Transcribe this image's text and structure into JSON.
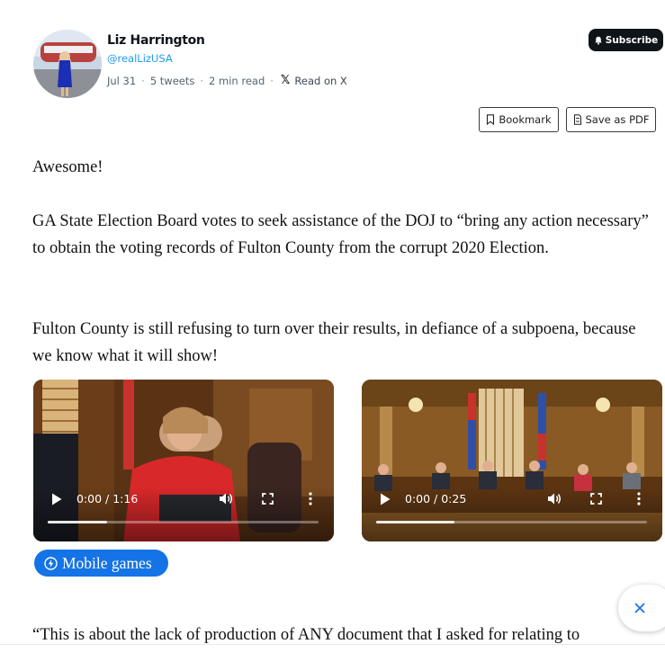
{
  "author": {
    "name": "Liz Harrington",
    "handle": "@realLizUSA",
    "date": "Jul 31",
    "tweets": "5 tweets",
    "read_time": "2 min read",
    "read_on": "Read on X"
  },
  "actions": {
    "subscribe": "Subscribe",
    "bookmark": "Bookmark",
    "save_pdf": "Save as PDF"
  },
  "thread": {
    "p1": "Awesome!",
    "p2": "GA State Election Board votes to seek assistance of the DOJ to “bring any action necessary” to obtain the voting records of Fulton County from the corrupt 2020 Election.",
    "p3": "Fulton County is still refusing to turn over their results, in defiance of a subpoena, because we know what it will show!",
    "p4": "“This is about the lack of production of ANY document that I asked for relating to"
  },
  "videos": [
    {
      "time": "0:00 / 1:16",
      "buffered": 0.22
    },
    {
      "time": "0:00 / 0:25",
      "buffered": 0.29
    }
  ],
  "ad_button": {
    "label": "Mobile games"
  },
  "colors": {
    "link": "#1d9bf0",
    "accent_button": "#1473e6",
    "dark": "#0f1419"
  },
  "icons": [
    "bell-icon",
    "bookmark-icon",
    "pdf-icon",
    "x-logo-icon",
    "play-icon",
    "volume-icon",
    "fullscreen-icon",
    "more-vertical-icon",
    "bolt-icon",
    "close-icon"
  ]
}
